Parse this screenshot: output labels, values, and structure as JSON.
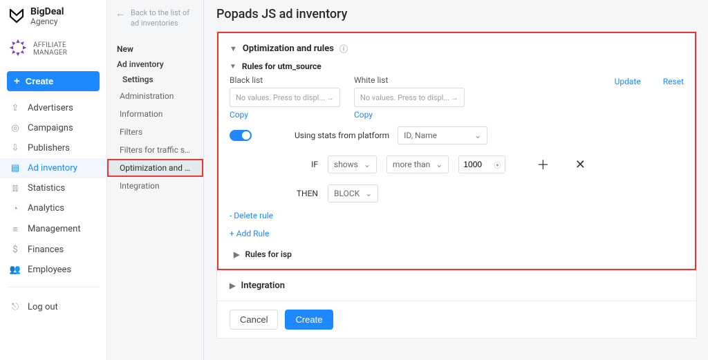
{
  "brand": {
    "name": "BigDeal",
    "sub": "Agency"
  },
  "affiliate_label": "AFFILIATE MANAGER",
  "create_label": "Create",
  "nav": {
    "advertisers": "Advertisers",
    "campaigns": "Campaigns",
    "publishers": "Publishers",
    "ad_inventory": "Ad inventory",
    "statistics": "Statistics",
    "analytics": "Analytics",
    "management": "Management",
    "finances": "Finances",
    "employees": "Employees",
    "logout": "Log out"
  },
  "panel2": {
    "back_text": "Back to the list of ad inventories",
    "section_new": "New",
    "ad_inventory": "Ad inventory",
    "settings": "Settings",
    "items": {
      "administration": "Administration",
      "information": "Information",
      "filters": "Filters",
      "filters_src": "Filters for traffic sour...",
      "optimization": "Optimization and rules",
      "integration": "Integration"
    }
  },
  "page": {
    "title": "Popads JS ad inventory",
    "opt_title": "Optimization and rules",
    "rules_utm_title": "Rules for utm_source",
    "black_list": "Black list",
    "white_list": "White list",
    "novals_placeholder": "No values. Press to displ...",
    "copy": "Copy",
    "update": "Update",
    "reset": "Reset",
    "using_stats": "Using stats from platform",
    "platform_value": "ID, Name",
    "if_label": "IF",
    "metric": "shows",
    "op": "more than",
    "value": "1000",
    "then_label": "THEN",
    "action": "BLOCK",
    "delete_rule": "- Delete rule",
    "add_rule": "+ Add Rule",
    "rules_isp": "Rules for isp",
    "integration": "Integration",
    "cancel": "Cancel",
    "create": "Create"
  }
}
